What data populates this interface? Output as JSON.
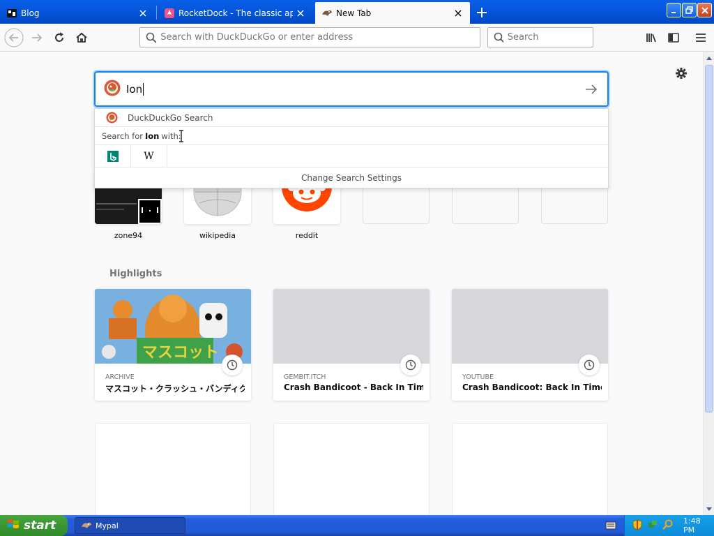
{
  "tabs": [
    {
      "title": "Blog",
      "active": false
    },
    {
      "title": "RocketDock - The classic app launcher",
      "active": false
    },
    {
      "title": "New Tab",
      "active": true
    }
  ],
  "toolbar": {
    "url_placeholder": "Search with DuckDuckGo or enter address",
    "search_placeholder": "Search"
  },
  "newtab": {
    "search_value": "Ion",
    "dropdown": {
      "engine_label": "DuckDuckGo Search",
      "search_for_prefix": "Search for",
      "search_for_query": "Ion",
      "search_for_suffix": "with:",
      "engines": [
        "bing",
        "wikipedia"
      ],
      "settings_label": "Change Search Settings"
    },
    "top_sites": [
      {
        "label": "zone94"
      },
      {
        "label": "wikipedia"
      },
      {
        "label": "reddit"
      },
      {
        "label": ""
      },
      {
        "label": ""
      },
      {
        "label": ""
      }
    ],
    "highlights_title": "Highlights",
    "highlights": [
      {
        "source": "ARCHIVE",
        "title": "マスコット・クラッシュ・バンディク..."
      },
      {
        "source": "GEMBIT.ITCH",
        "title": "Crash Bandicoot - Back In Time ..."
      },
      {
        "source": "YOUTUBE",
        "title": "Crash Bandicoot: Back In Time - ..."
      }
    ]
  },
  "taskbar": {
    "start_label": "start",
    "task_label": "Mypal",
    "clock": "1:48 PM"
  },
  "colors": {
    "accent": "#0a84ff",
    "title_bar": "#0352d6",
    "taskbar": "#245edc",
    "start_green": "#3c9a35",
    "reddit": "#ff4500"
  }
}
